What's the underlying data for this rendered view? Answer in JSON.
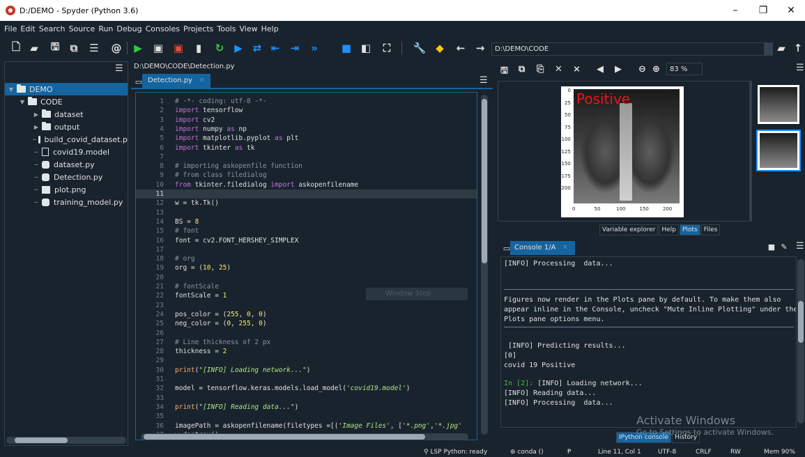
{
  "window": {
    "title": "D:/DEMO - Spyder (Python 3.6)",
    "minimize": "–",
    "maximize": "❐",
    "close": "✕"
  },
  "menu": [
    "File",
    "Edit",
    "Search",
    "Source",
    "Run",
    "Debug",
    "Consoles",
    "Projects",
    "Tools",
    "View",
    "Help"
  ],
  "toolbar": {
    "working_dir": "D:\\DEMO\\CODE"
  },
  "files": {
    "tree": [
      {
        "label": "DEMO",
        "type": "folder",
        "level": 0,
        "expanded": true,
        "selected": true
      },
      {
        "label": "CODE",
        "type": "folder",
        "level": 1,
        "expanded": true
      },
      {
        "label": "dataset",
        "type": "folder",
        "level": 2,
        "expanded": false
      },
      {
        "label": "output",
        "type": "folder",
        "level": 2,
        "expanded": false
      },
      {
        "label": "build_covid_dataset.p",
        "type": "py",
        "level": 2
      },
      {
        "label": "covid19.model",
        "type": "file",
        "level": 2
      },
      {
        "label": "dataset.py",
        "type": "py",
        "level": 2
      },
      {
        "label": "Detection.py",
        "type": "py",
        "level": 2
      },
      {
        "label": "plot.png",
        "type": "image",
        "level": 2
      },
      {
        "label": "training_model.py",
        "type": "py",
        "level": 2
      }
    ]
  },
  "editor": {
    "path": "D:\\DEMO\\CODE\\Detection.py",
    "tab_label": "Detection.py",
    "current_line": 11,
    "lines": [
      {
        "n": "1",
        "html": "<span class=\"c-cmt\"># -*- coding: utf-8 -*-</span>"
      },
      {
        "n": "2",
        "html": "<span class=\"c-kw\">import</span> tensorflow"
      },
      {
        "n": "3",
        "html": "<span class=\"c-kw\">import</span> cv2"
      },
      {
        "n": "4",
        "html": "<span class=\"c-kw\">import</span> numpy <span class=\"c-kw\">as</span> np"
      },
      {
        "n": "5",
        "html": "<span class=\"c-kw\">import</span> matplotlib.pyplot <span class=\"c-kw\">as</span> plt"
      },
      {
        "n": "6",
        "html": "<span class=\"c-kw\">import</span> tkinter <span class=\"c-kw\">as</span> tk"
      },
      {
        "n": "7",
        "html": ""
      },
      {
        "n": "8",
        "html": "<span class=\"c-cmt\"># importing askopenfile function</span>"
      },
      {
        "n": "9",
        "html": "<span class=\"c-cmt\"># from class filedialog</span>"
      },
      {
        "n": "10",
        "html": "<span class=\"c-kw\">from</span> tkinter.filedialog <span class=\"c-kw\">import</span> askopenfilename"
      },
      {
        "n": "11",
        "html": ""
      },
      {
        "n": "12",
        "html": "w = tk.Tk()"
      },
      {
        "n": "13",
        "html": ""
      },
      {
        "n": "14",
        "html": "BS = <span class=\"c-num\">8</span>"
      },
      {
        "n": "15",
        "html": "<span class=\"c-cmt\"># font</span>"
      },
      {
        "n": "16",
        "html": "font = cv2.FONT_HERSHEY_SIMPLEX"
      },
      {
        "n": "17",
        "html": ""
      },
      {
        "n": "18",
        "html": "<span class=\"c-cmt\"># org</span>"
      },
      {
        "n": "19",
        "html": "org = (<span class=\"c-num\">10</span>, <span class=\"c-num\">25</span>)"
      },
      {
        "n": "20",
        "html": ""
      },
      {
        "n": "21",
        "html": "<span class=\"c-cmt\"># fontScale</span>"
      },
      {
        "n": "22",
        "html": "fontScale = <span class=\"c-num\">1</span>"
      },
      {
        "n": "23",
        "html": ""
      },
      {
        "n": "24",
        "html": "pos_color = (<span class=\"c-num\">255</span>, <span class=\"c-num\">0</span>, <span class=\"c-num\">0</span>)"
      },
      {
        "n": "25",
        "html": "neg_color = (<span class=\"c-num\">0</span>, <span class=\"c-num\">255</span>, <span class=\"c-num\">0</span>)"
      },
      {
        "n": "26",
        "html": ""
      },
      {
        "n": "27",
        "html": "<span class=\"c-cmt\"># Line thickness of 2 px</span>"
      },
      {
        "n": "28",
        "html": "thickness = <span class=\"c-num\">2</span>"
      },
      {
        "n": "29",
        "html": ""
      },
      {
        "n": "30",
        "html": "<span class=\"c-bi\">print</span>(<span class=\"c-str\">\"[INFO] Loading network...\"</span>)"
      },
      {
        "n": "31",
        "html": ""
      },
      {
        "n": "32",
        "html": "model = tensorflow.keras.models.load_model(<span class=\"c-str\">'covid19.model'</span>)"
      },
      {
        "n": "33",
        "html": ""
      },
      {
        "n": "34",
        "html": "<span class=\"c-bi\">print</span>(<span class=\"c-str\">\"[INFO] Reading data...\"</span>)"
      },
      {
        "n": "35",
        "html": ""
      },
      {
        "n": "36",
        "html": "imagePath = askopenfilename(filetypes =[(<span class=\"c-str\">'Image Files'</span>, [<span class=\"c-str\">'*.png'</span>,<span class=\"c-str\">'*.jpg'</span>"
      },
      {
        "n": "37",
        "html": "w.destroy()"
      }
    ],
    "hover_hint": "Window Step"
  },
  "plots": {
    "zoom": "83 %",
    "figure_label": "Positive",
    "y_ticks": [
      "0",
      "25",
      "50",
      "75",
      "100",
      "125",
      "150",
      "175",
      "200"
    ],
    "x_ticks": [
      "0",
      "50",
      "100",
      "150",
      "200"
    ],
    "tabs": [
      "Variable explorer",
      "Help",
      "Plots",
      "Files"
    ],
    "active_tab": "Plots",
    "label_color": "#e8151b"
  },
  "console": {
    "tab_label": "Console 1/A",
    "lines": [
      {
        "text": "[INFO] Processing  data...",
        "style": ""
      },
      {
        "text": "Figures now render in the Plots pane by default. To make them also",
        "style": ""
      },
      {
        "text": "appear inline in the Console, uncheck \"Mute Inline Plotting\" under the",
        "style": ""
      },
      {
        "text": "Plots pane options menu.",
        "style": ""
      },
      {
        "text": " [INFO] Predicting results...",
        "style": ""
      },
      {
        "text": "[0]",
        "style": ""
      },
      {
        "text": "covid 19 Positive",
        "style": ""
      },
      {
        "text": "In [2]: [INFO] Loading network...",
        "style": "green-prefix"
      },
      {
        "text": "[INFO] Reading data...",
        "style": ""
      },
      {
        "text": "[INFO] Processing  data...",
        "style": ""
      }
    ],
    "prompt_prefix": "In [2]:",
    "prompt_rest": " [INFO] Loading network...",
    "tabs": [
      "IPython console",
      "History"
    ],
    "active_tab": "IPython console"
  },
  "watermark": {
    "line1": "Activate Windows",
    "line2": "Go to Settings to activate Windows."
  },
  "status": {
    "lsp": "LSP Python: ready",
    "conda": "conda ()",
    "position": "Line 11, Col 1",
    "encoding": "UTF-8",
    "eol": "CRLF",
    "rw": "RW",
    "mem": "Mem 90%"
  }
}
